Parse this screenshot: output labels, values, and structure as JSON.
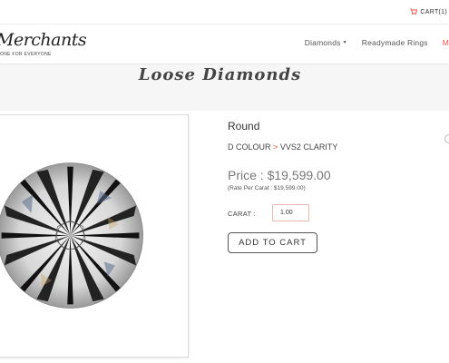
{
  "topbar": {
    "cart_label": "CART(1)",
    "cart_icon": "cart-icon"
  },
  "brand": {
    "name": "Merchants",
    "tagline": "ONE FOR EVERYONE"
  },
  "nav": {
    "items": [
      {
        "label": "Diamonds",
        "has_dropdown": true
      },
      {
        "label": "Readymade Rings",
        "has_dropdown": false
      }
    ],
    "overflow_label": "M"
  },
  "page": {
    "title": "Loose Diamonds"
  },
  "product": {
    "shape": "Round",
    "colour": "D COLOUR",
    "separator": ">",
    "clarity": "VVS2 CLARITY",
    "price": "Price : $19,599.00",
    "rate": "(Rate Per Carat : $19,599.00)",
    "carat_label": "CARAT :",
    "carat_value": "1.00",
    "add_to_cart_label": "ADD TO CART",
    "image_icon": "round-diamond-image"
  },
  "colors": {
    "accent": "#e8564a",
    "text": "#333333",
    "muted": "#777777",
    "banner": "#f6f6f6"
  }
}
